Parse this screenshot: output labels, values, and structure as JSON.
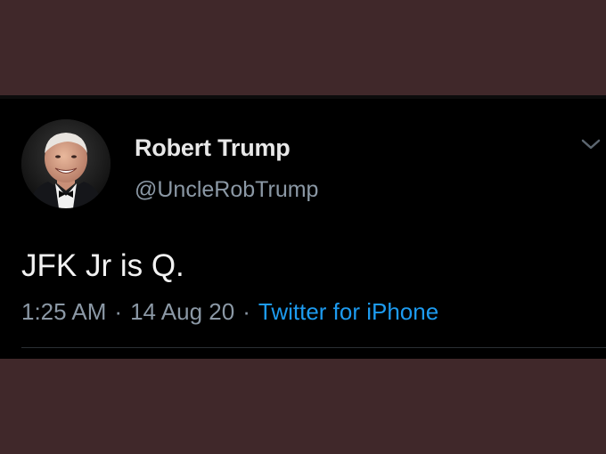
{
  "tweet": {
    "display_name": "Robert Trump",
    "handle": "@UncleRobTrump",
    "text": "JFK Jr is Q.",
    "time": "1:25 AM",
    "date": "14 Aug 20",
    "separator": "·",
    "source": "Twitter for iPhone",
    "avatar_icon": "profile-photo",
    "more_icon": "chevron-down-icon"
  },
  "colors": {
    "page_background": "#40282a",
    "card_background": "#000000",
    "name_text": "#e8e8e8",
    "secondary_text": "#8b98a5",
    "link_blue": "#1d9bf0"
  }
}
